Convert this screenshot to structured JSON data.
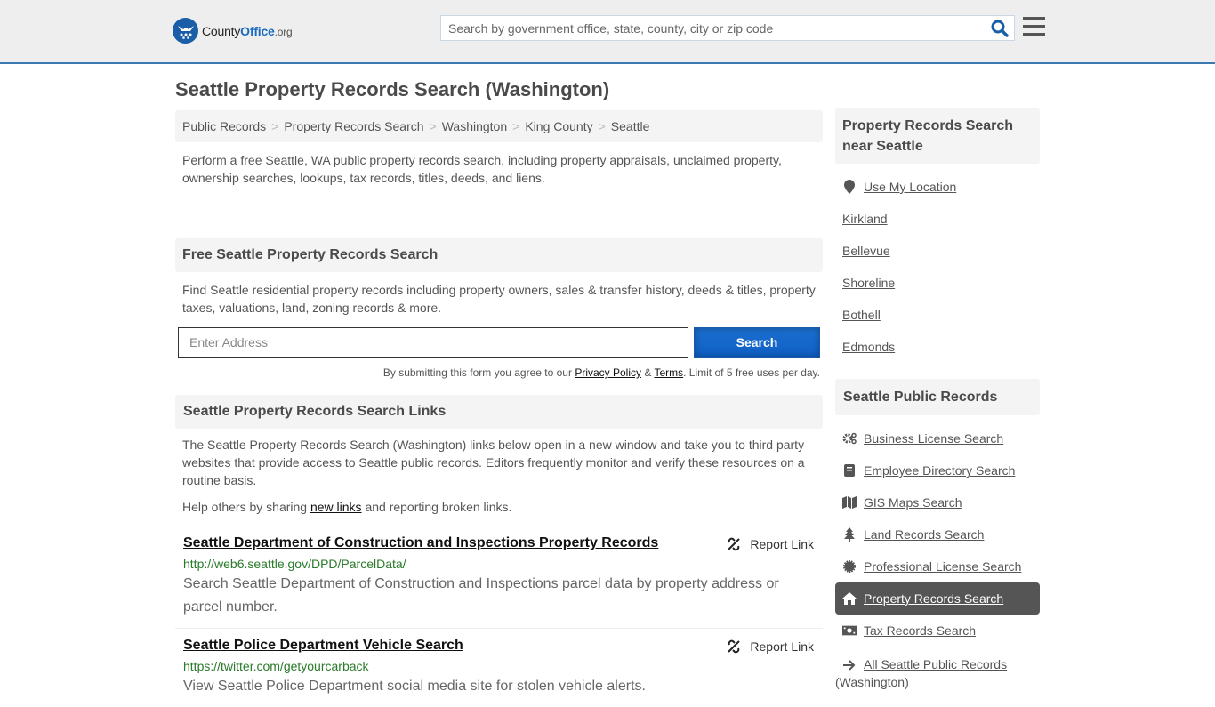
{
  "header": {
    "logo": {
      "part1": "County",
      "part2": "Office",
      "part3": ".org"
    },
    "search_placeholder": "Search by government office, state, county, city or zip code",
    "accent_color": "#3a7ab0"
  },
  "page_title": "Seattle Property Records Search (Washington)",
  "breadcrumb": [
    "Public Records",
    "Property Records Search",
    "Washington",
    "King County",
    "Seattle"
  ],
  "intro": "Perform a free Seattle, WA public property records search, including property appraisals, unclaimed property, ownership searches, lookups, tax records, titles, deeds, and liens.",
  "free_search": {
    "heading": "Free Seattle Property Records Search",
    "description": "Find Seattle residential property records including property owners, sales & transfer history, deeds & titles, property taxes, valuations, land, zoning records & more.",
    "address_placeholder": "Enter Address",
    "search_button": "Search",
    "disclaimer_prefix": "By submitting this form you agree to our ",
    "privacy_label": "Privacy Policy",
    "amp": " & ",
    "terms_label": "Terms",
    "disclaimer_suffix": ". Limit of 5 free uses per day."
  },
  "links_section": {
    "heading": "Seattle Property Records Search Links",
    "description": "The Seattle Property Records Search (Washington) links below open in a new window and take you to third party websites that provide access to Seattle public records. Editors frequently monitor and verify these resources on a routine basis.",
    "help_prefix": "Help others by sharing ",
    "help_link": "new links",
    "help_suffix": " and reporting broken links.",
    "report_label": "Report Link",
    "items": [
      {
        "title": "Seattle Department of Construction and Inspections Property Records",
        "url": "http://web6.seattle.gov/DPD/ParcelData/",
        "description": "Search Seattle Department of Construction and Inspections parcel data by property address or parcel number."
      },
      {
        "title": "Seattle Police Department Vehicle Search",
        "url": "https://twitter.com/getyourcarback",
        "description": "View Seattle Police Department social media site for stolen vehicle alerts."
      }
    ]
  },
  "sidebar": {
    "nearby_heading": "Property Records Search near Seattle",
    "use_location": "Use My Location",
    "nearby": [
      "Kirkland",
      "Bellevue",
      "Shoreline",
      "Bothell",
      "Edmonds"
    ],
    "public_records_heading": "Seattle Public Records",
    "records": [
      {
        "label": "Business License Search",
        "icon": "gears-icon"
      },
      {
        "label": "Employee Directory Search",
        "icon": "book-icon"
      },
      {
        "label": "GIS Maps Search",
        "icon": "map-icon"
      },
      {
        "label": "Land Records Search",
        "icon": "tree-icon"
      },
      {
        "label": "Professional License Search",
        "icon": "certificate-icon"
      },
      {
        "label": "Property Records Search",
        "icon": "home-icon",
        "active": true
      },
      {
        "label": "Tax Records Search",
        "icon": "money-icon"
      },
      {
        "label": "All Seattle Public Records",
        "icon": "arrow-right-icon"
      }
    ],
    "all_records_suffix": "(Washington)"
  }
}
